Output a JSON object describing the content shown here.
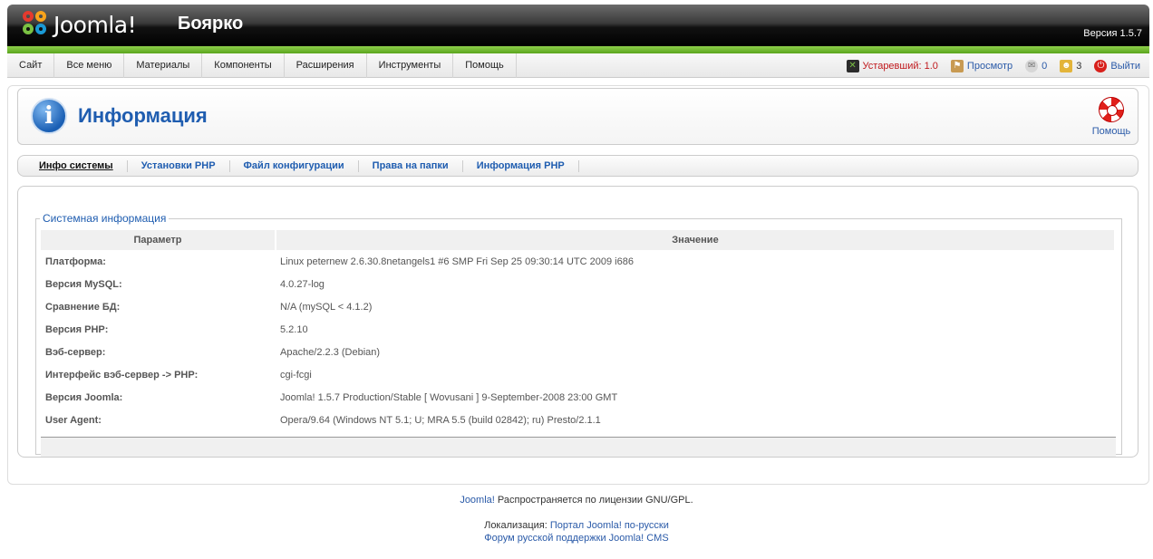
{
  "header": {
    "logo_text": "Joomla!",
    "site_name": "Боярко",
    "version": "Версия 1.5.7"
  },
  "menu": [
    "Сайт",
    "Все меню",
    "Материалы",
    "Компоненты",
    "Расширения",
    "Инструменты",
    "Помощь"
  ],
  "status": {
    "outdated": "Устаревший: 1.0",
    "preview": "Просмотр",
    "messages": "0",
    "users": "3",
    "logout": "Выйти"
  },
  "toolbar": {
    "title": "Информация",
    "help_label": "Помощь"
  },
  "tabs": [
    "Инфо системы",
    "Установки PHP",
    "Файл конфигурации",
    "Права на папки",
    "Информация PHP"
  ],
  "panel": {
    "legend": "Системная информация",
    "col_param": "Параметр",
    "col_value": "Значение",
    "rows": [
      {
        "k": "Платформа:",
        "v": "Linux peternew 2.6.30.8netangels1 #6 SMP Fri Sep 25 09:30:14 UTC 2009 i686"
      },
      {
        "k": "Версия MySQL:",
        "v": "4.0.27-log"
      },
      {
        "k": "Сравнение БД:",
        "v": "N/A (mySQL < 4.1.2)"
      },
      {
        "k": "Версия PHP:",
        "v": "5.2.10"
      },
      {
        "k": "Вэб-сервер:",
        "v": "Apache/2.2.3 (Debian)"
      },
      {
        "k": "Интерфейс вэб-сервер -> PHP:",
        "v": "cgi-fcgi"
      },
      {
        "k": "Версия Joomla:",
        "v": "Joomla! 1.5.7 Production/Stable [ Wovusani ] 9-September-2008 23:00 GMT"
      },
      {
        "k": "User Agent:",
        "v": "Opera/9.64 (Windows NT 5.1; U; MRA 5.5 (build 02842); ru) Presto/2.1.1"
      }
    ]
  },
  "footer": {
    "joomla_link": "Joomla!",
    "license": " Распространяется по лицензии GNU/GPL.",
    "loc_label": "Локализация: ",
    "loc_link": "Портал Joomla! по-русски",
    "forum_link": "Форум русской поддержки Joomla! CMS"
  }
}
